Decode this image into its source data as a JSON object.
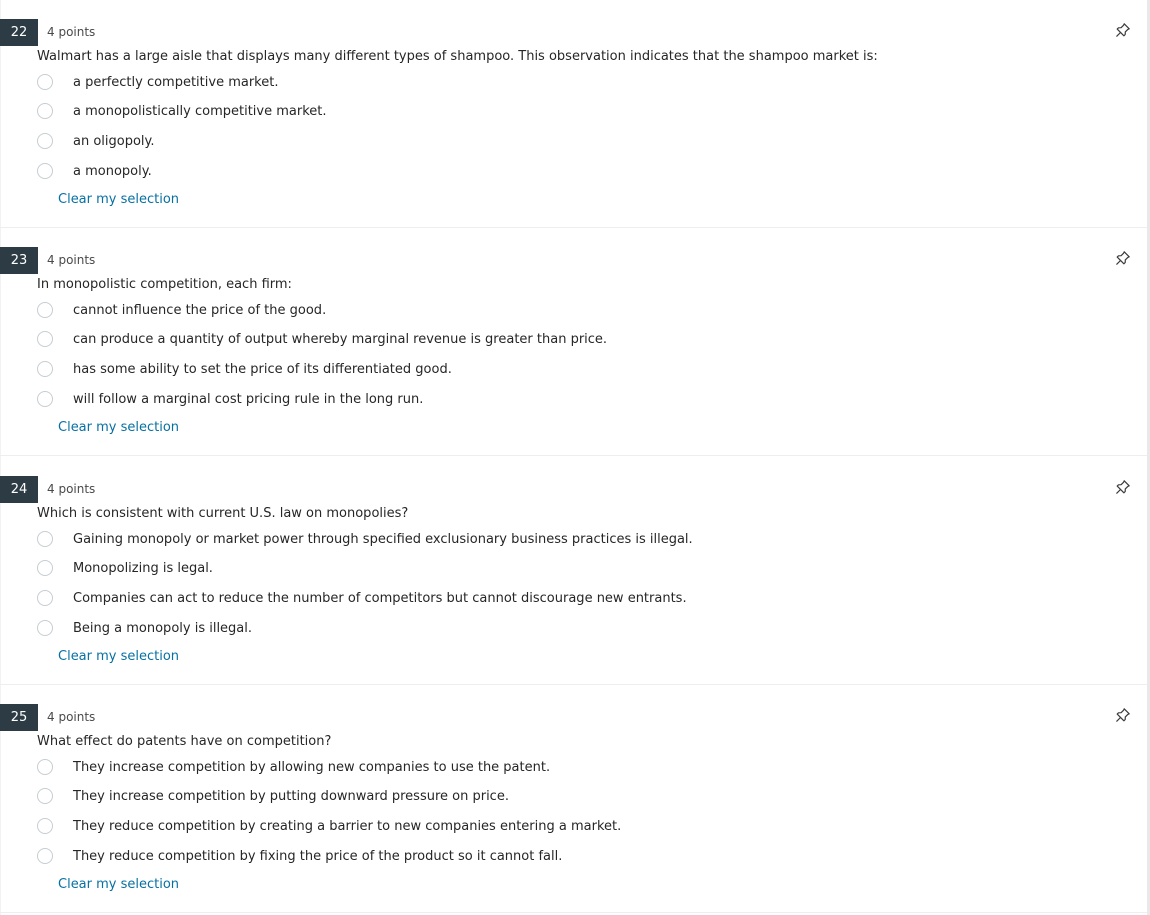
{
  "questions": [
    {
      "number": "22",
      "points": "4 points",
      "text": "Walmart has a large aisle that displays many different types of shampoo. This observation indicates that the shampoo market is:",
      "answers": [
        "a perfectly competitive market.",
        "a monopolistically competitive market.",
        "an oligopoly.",
        "a monopoly."
      ],
      "clear_label": "Clear my selection",
      "pin_icon": "pin-icon"
    },
    {
      "number": "23",
      "points": "4 points",
      "text": "In monopolistic competition, each firm:",
      "answers": [
        "cannot influence the price of the good.",
        "can produce a quantity of output whereby marginal revenue is greater than price.",
        "has some ability to set the price of its differentiated good.",
        "will follow a marginal cost pricing rule in the long run."
      ],
      "clear_label": "Clear my selection",
      "pin_icon": "pin-icon"
    },
    {
      "number": "24",
      "points": "4 points",
      "text": "Which is consistent with current U.S. law on monopolies?",
      "answers": [
        "Gaining monopoly or market power through specified exclusionary business practices is illegal.",
        "Monopolizing is legal.",
        "Companies can act to reduce the number of competitors but cannot discourage new entrants.",
        "Being a monopoly is illegal."
      ],
      "clear_label": "Clear my selection",
      "pin_icon": "pin-icon"
    },
    {
      "number": "25",
      "points": "4 points",
      "text": "What effect do patents have on competition?",
      "answers": [
        "They increase competition by allowing new companies to use the patent.",
        "They increase competition by putting downward pressure on price.",
        "They reduce competition by creating a barrier to new companies entering a market.",
        "They reduce competition by fixing the price of the product so it cannot fall."
      ],
      "clear_label": "Clear my selection",
      "pin_icon": "pin-icon"
    }
  ],
  "colors": {
    "number_badge": "#2d3b45",
    "link": "#0770a3",
    "radio_border": "#c7cdd1"
  }
}
